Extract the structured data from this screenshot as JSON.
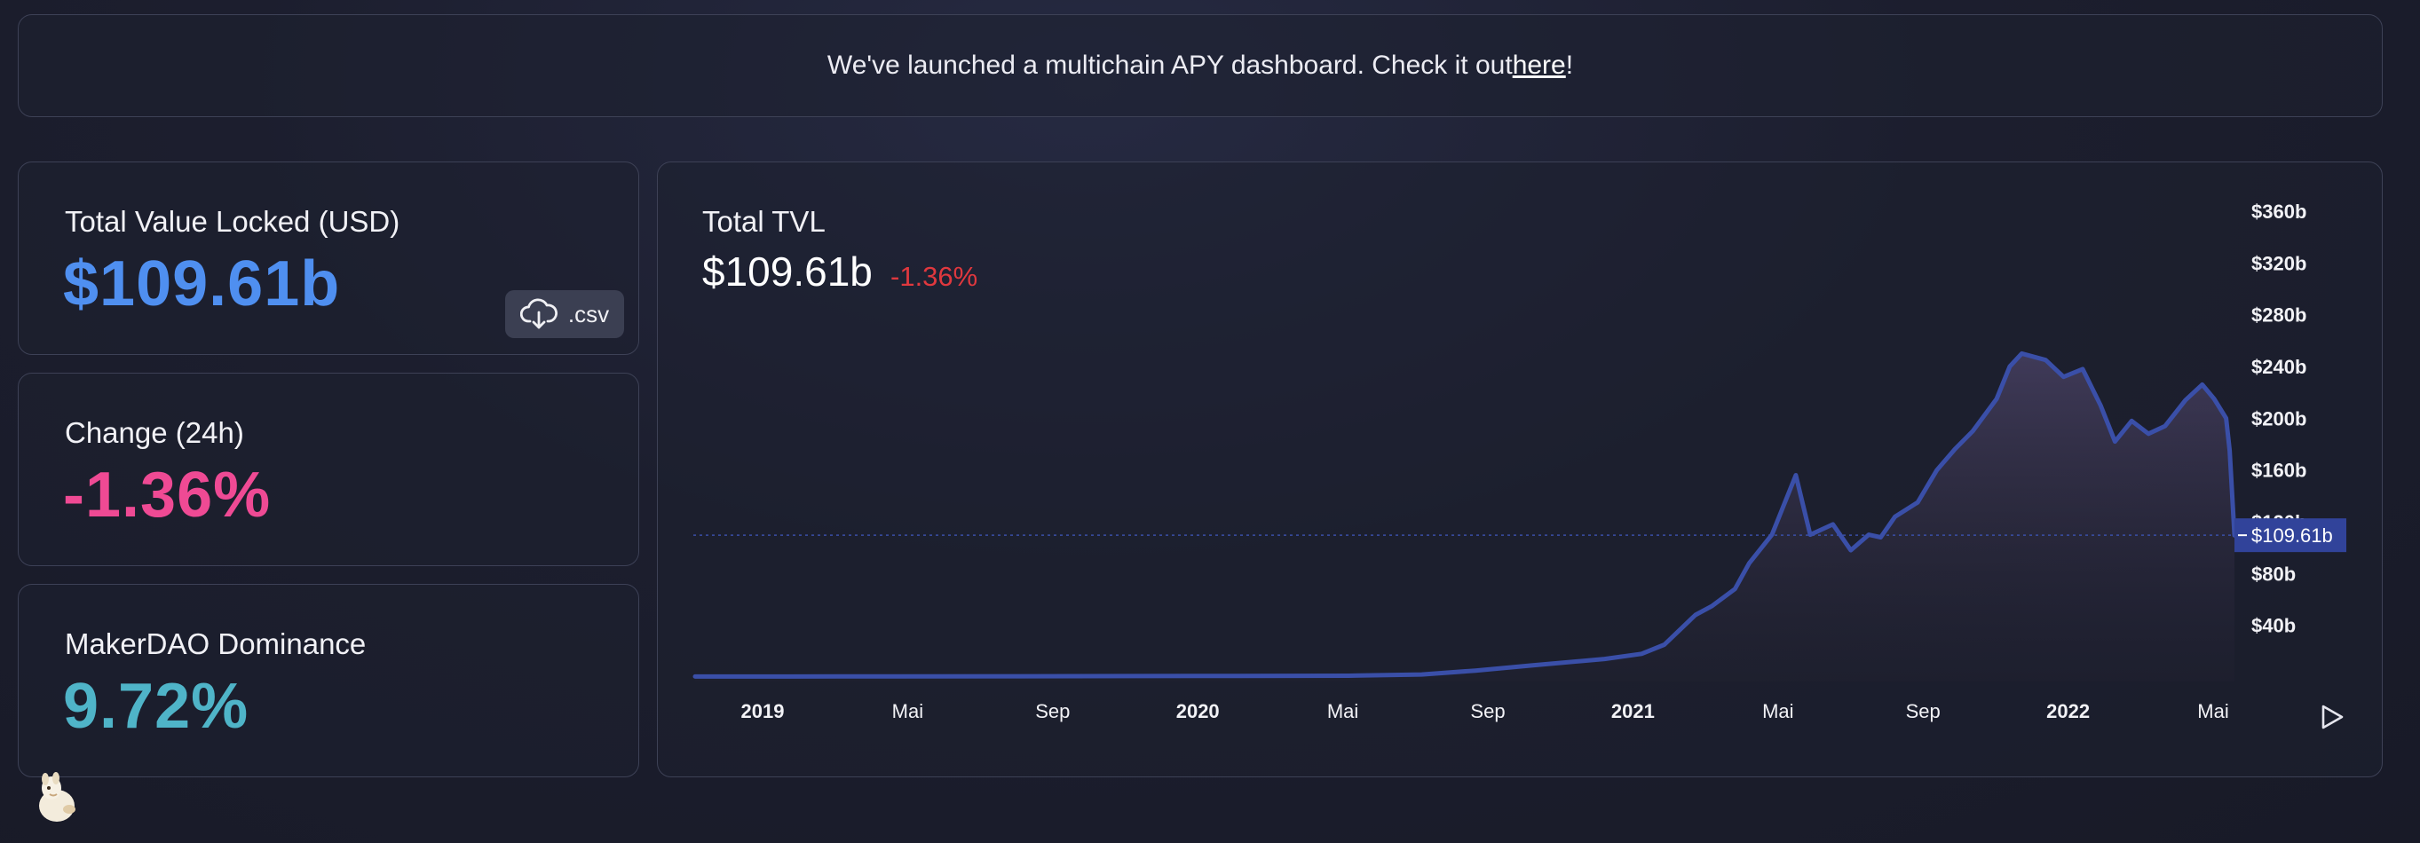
{
  "banner": {
    "text_before": "We've launched a multichain APY dashboard. Check it out ",
    "link_text": "here",
    "text_after": "!"
  },
  "stats": {
    "tvl": {
      "label": "Total Value Locked (USD)",
      "value": "$109.61b"
    },
    "change": {
      "label": "Change (24h)",
      "value": "-1.36%"
    },
    "dominance": {
      "label": "MakerDAO Dominance",
      "value": "9.72%"
    }
  },
  "download": {
    "label": ".csv",
    "icon": "cloud-download-icon"
  },
  "chart_header": {
    "title": "Total TVL",
    "value": "$109.61b",
    "change": "-1.36%"
  },
  "colors": {
    "tvl_value": "#4f8ff0",
    "change_value": "#ef4a94",
    "dominance_value": "#4fb4c8",
    "negative_change": "#e0383e",
    "series_line": "#3a4fa8",
    "price_tag": "#31439a"
  },
  "chart_data": {
    "type": "area",
    "title": "Total TVL",
    "xlabel": "",
    "ylabel": "",
    "x_ticks": [
      "2019",
      "Mai",
      "Sep",
      "2020",
      "Mai",
      "Sep",
      "2021",
      "Mai",
      "Sep",
      "2022",
      "Mai"
    ],
    "x_tick_bold": [
      true,
      false,
      false,
      true,
      false,
      false,
      true,
      false,
      false,
      true,
      false
    ],
    "y_ticks": [
      "$40b",
      "$80b",
      "$120b",
      "$160b",
      "$200b",
      "$240b",
      "$280b",
      "$320b",
      "$360b"
    ],
    "ylim": [
      0,
      360
    ],
    "xlim": [
      "2018-11-01",
      "2022-05-12"
    ],
    "grid": false,
    "current_label": "$109.61b",
    "current_value": 109.61,
    "series": [
      {
        "x": [
          "2018-11-01",
          "2019-03-01",
          "2019-08-01",
          "2020-01-01",
          "2020-05-01",
          "2020-07-01",
          "2020-08-15",
          "2020-10-01",
          "2020-12-01",
          "2021-01-01",
          "2021-01-20",
          "2021-02-15",
          "2021-03-01",
          "2021-03-20",
          "2021-04-01",
          "2021-04-20",
          "2021-05-10",
          "2021-05-22",
          "2021-06-10",
          "2021-06-25",
          "2021-07-10",
          "2021-07-20",
          "2021-08-01",
          "2021-08-20",
          "2021-09-05",
          "2021-09-20",
          "2021-10-05",
          "2021-10-25",
          "2021-11-05",
          "2021-11-15",
          "2021-12-05",
          "2021-12-20",
          "2022-01-05",
          "2022-01-20",
          "2022-02-01",
          "2022-02-15",
          "2022-03-01",
          "2022-03-15",
          "2022-04-01",
          "2022-04-15",
          "2022-04-25",
          "2022-05-05",
          "2022-05-08",
          "2022-05-12"
        ],
        "y": [
          0.4,
          0.5,
          0.6,
          0.8,
          1.0,
          2.0,
          5.0,
          9.0,
          14.0,
          18.0,
          25.0,
          48.0,
          55.0,
          68.0,
          88.0,
          110.0,
          156.0,
          110.0,
          118.0,
          98.0,
          110.0,
          108.0,
          124.0,
          135.0,
          160.0,
          176.0,
          190.0,
          215.0,
          240.0,
          250.0,
          245.0,
          232.0,
          238.0,
          210.0,
          182.0,
          198.0,
          188.0,
          194.0,
          214.0,
          226.0,
          215.0,
          200.0,
          175.0,
          109.61
        ]
      }
    ]
  }
}
